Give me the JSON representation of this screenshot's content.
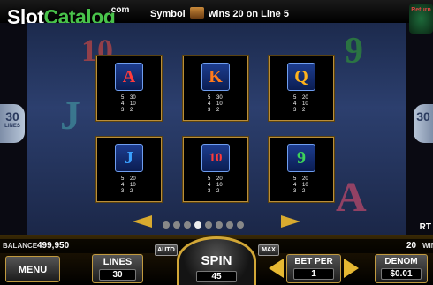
{
  "header": {
    "logo_main": "Slot",
    "logo_accent": "Catalog",
    "logo_suffix": ".com",
    "win_prefix": "Symbol",
    "win_suffix": "wins 20 on Line 5",
    "corner_logo": "Return"
  },
  "side": {
    "lines_value": "30",
    "lines_label": "LINES",
    "right_value": "30"
  },
  "paytable": [
    {
      "symbol": "A",
      "color": "#ff3b3b",
      "rows": [
        [
          "5",
          "30"
        ],
        [
          "4",
          "10"
        ],
        [
          "3",
          "2"
        ]
      ]
    },
    {
      "symbol": "K",
      "color": "#ff7a1a",
      "rows": [
        [
          "5",
          "30"
        ],
        [
          "4",
          "10"
        ],
        [
          "3",
          "2"
        ]
      ]
    },
    {
      "symbol": "Q",
      "color": "#ffb21c",
      "rows": [
        [
          "5",
          "20"
        ],
        [
          "4",
          "10"
        ],
        [
          "3",
          "2"
        ]
      ]
    },
    {
      "symbol": "J",
      "color": "#3aa0ff",
      "rows": [
        [
          "5",
          "20"
        ],
        [
          "4",
          "10"
        ],
        [
          "3",
          "2"
        ]
      ]
    },
    {
      "symbol": "10",
      "color": "#ff3b3b",
      "rows": [
        [
          "5",
          "20"
        ],
        [
          "4",
          "10"
        ],
        [
          "3",
          "2"
        ]
      ]
    },
    {
      "symbol": "9",
      "color": "#3cd25a",
      "rows": [
        [
          "5",
          "20"
        ],
        [
          "4",
          "10"
        ],
        [
          "3",
          "2"
        ]
      ]
    }
  ],
  "reels_bg": {
    "top_left": "10",
    "mid_left": "J",
    "top_right": "9",
    "bottom_right": "A"
  },
  "pager": {
    "count": 8,
    "active": 3
  },
  "right_edge": "RT",
  "status": {
    "balance_label": "BALANCE",
    "balance_value": "499,950",
    "win_value": "20",
    "win_label": "WIN"
  },
  "controls": {
    "menu": "MENU",
    "lines_label": "LINES",
    "lines_value": "30",
    "auto": "AUTO",
    "max": "MAX",
    "spin_label": "SPIN",
    "spin_value": "45",
    "betper_label": "BET PER",
    "betper_value": "1",
    "denom_label": "DENOM",
    "denom_value": "$0.01"
  },
  "colors": {
    "gold": "#d2a737",
    "reel_bg": "#2c3f6e"
  }
}
